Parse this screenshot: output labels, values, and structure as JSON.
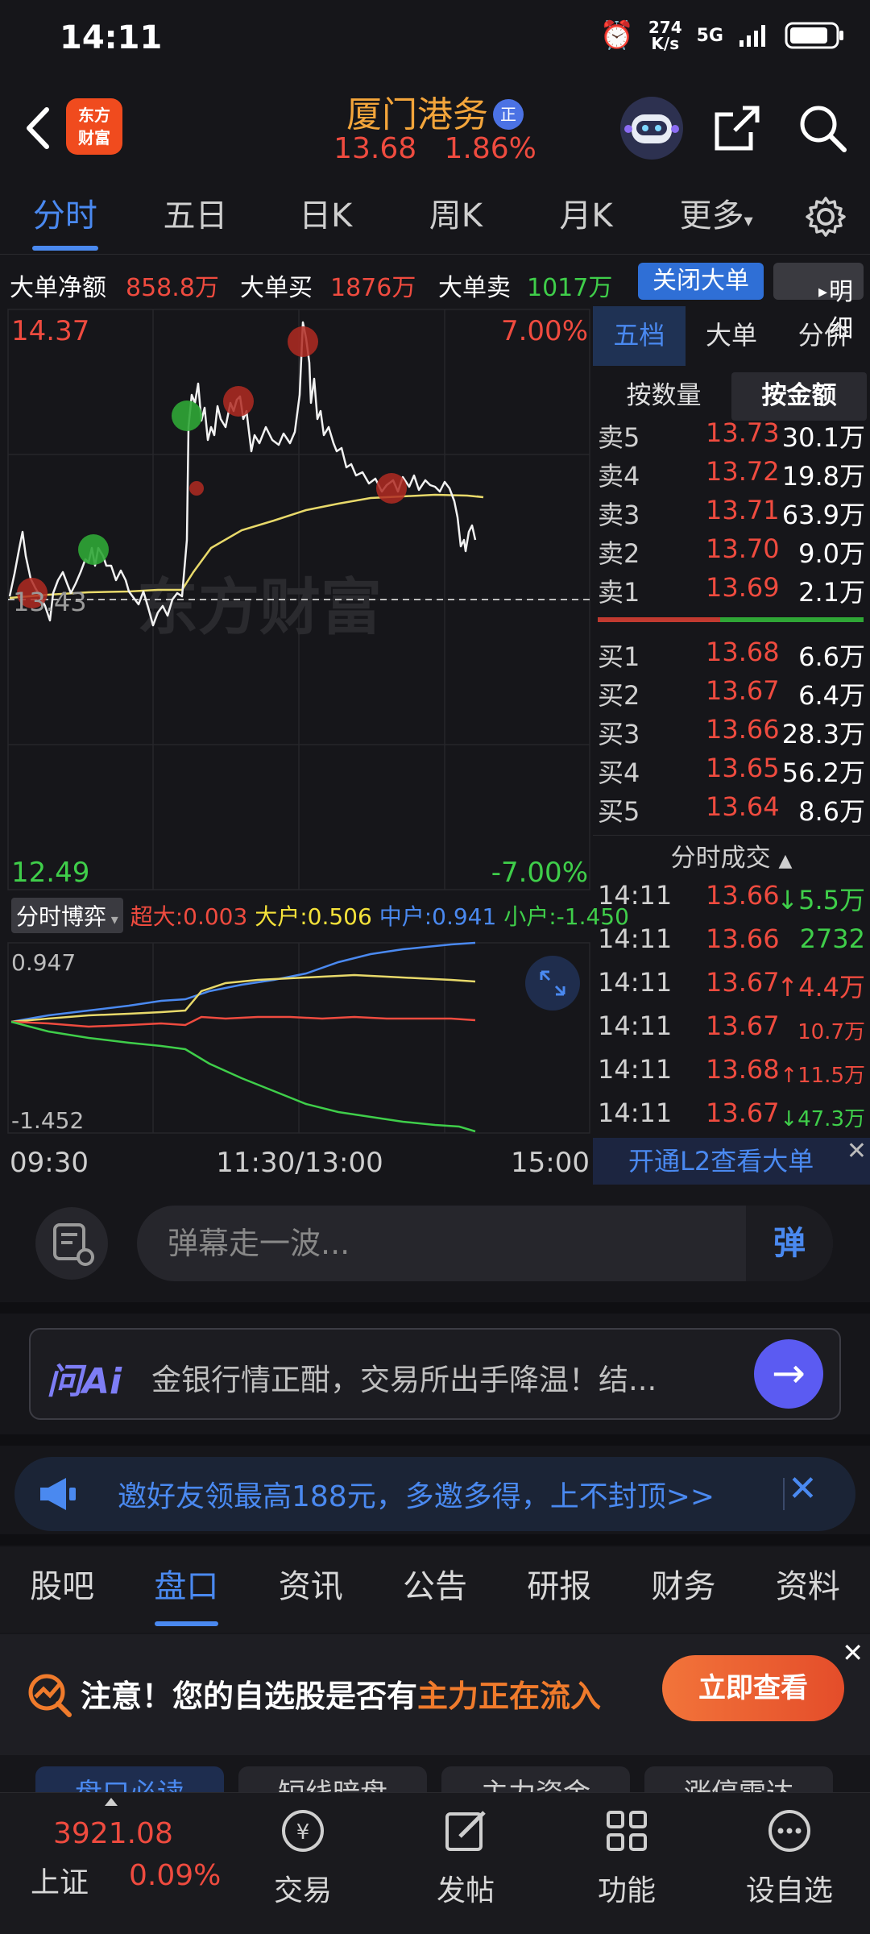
{
  "status_bar": {
    "time": "14:11",
    "net_speed_top": "274",
    "net_speed_bottom": "K/s",
    "network": "5G"
  },
  "header": {
    "logo_line1": "东方",
    "logo_line2": "财富",
    "stock_name": "厦门港务",
    "tag": "正",
    "price": "13.68",
    "change_pct": "1.86%"
  },
  "tabs": [
    "分时",
    "五日",
    "日K",
    "周K",
    "月K",
    "更多"
  ],
  "big_order": {
    "net_label": "大单净额",
    "net_value": "858.8万",
    "buy_label": "大单买",
    "buy_value": "1876万",
    "sell_label": "大单卖",
    "sell_value": "1017万",
    "close_btn": "关闭大单",
    "detail_btn": "明细"
  },
  "chart": {
    "price_high": "14.37",
    "pct_high": "7.00%",
    "price_low": "12.49",
    "pct_low": "-7.00%",
    "ref_price": "13.43",
    "watermark": "东方财富",
    "sub_selector": "分时博弈",
    "sub_legend": [
      {
        "label": "超大:",
        "value": "0.003",
        "color": "#ef4b3f"
      },
      {
        "label": "大户:",
        "value": "0.506",
        "color": "#f5e23a"
      },
      {
        "label": "中户:",
        "value": "0.941",
        "color": "#4a89f0"
      },
      {
        "label": "小户:",
        "value": "-1.450",
        "color": "#3fce4a"
      }
    ],
    "sub_max": "0.947",
    "sub_min": "-1.452",
    "time_labels": [
      "09:30",
      "11:30/13:00",
      "15:00"
    ]
  },
  "right_panel": {
    "tabs": [
      "五档",
      "大单",
      "分价"
    ],
    "seg": [
      "按数量",
      "按金额"
    ],
    "sells": [
      {
        "label": "卖5",
        "price": "13.73",
        "vol": "30.1万"
      },
      {
        "label": "卖4",
        "price": "13.72",
        "vol": "19.8万"
      },
      {
        "label": "卖3",
        "price": "13.71",
        "vol": "63.9万"
      },
      {
        "label": "卖2",
        "price": "13.70",
        "vol": "9.0万"
      },
      {
        "label": "卖1",
        "price": "13.69",
        "vol": "2.1万"
      }
    ],
    "buys": [
      {
        "label": "买1",
        "price": "13.68",
        "vol": "6.6万"
      },
      {
        "label": "买2",
        "price": "13.67",
        "vol": "6.4万"
      },
      {
        "label": "买3",
        "price": "13.66",
        "vol": "28.3万"
      },
      {
        "label": "买4",
        "price": "13.65",
        "vol": "56.2万"
      },
      {
        "label": "买5",
        "price": "13.64",
        "vol": "8.6万"
      }
    ],
    "ticks_title": "分时成交",
    "ticks": [
      {
        "time": "14:11",
        "price": "13.66",
        "vol": "↓5.5万",
        "color": "#3fce4a"
      },
      {
        "time": "14:11",
        "price": "13.66",
        "vol": "2732",
        "color": "#3fce4a"
      },
      {
        "time": "14:11",
        "price": "13.67",
        "vol": "↑4.4万",
        "color": "#ef4b3f"
      },
      {
        "time": "14:11",
        "price": "13.67",
        "vol": "10.7万",
        "color": "#ef4b3f"
      },
      {
        "time": "14:11",
        "price": "13.68",
        "vol": "↑11.5万",
        "color": "#ef4b3f"
      },
      {
        "time": "14:11",
        "price": "13.67",
        "vol": "↓47.3万",
        "color": "#3fce4a"
      }
    ],
    "l2_link": "开通L2查看大单"
  },
  "danmu": {
    "placeholder": "弹幕走一波...",
    "btn": "弹"
  },
  "ai": {
    "logo": "问Ai",
    "text": "金银行情正酣，交易所出手降温！结..."
  },
  "invite": {
    "text": "邀好友领最高188元，多邀多得，上不封顶>>"
  },
  "bottom_tabs": [
    "股吧",
    "盘口",
    "资讯",
    "公告",
    "研报",
    "财务",
    "资料"
  ],
  "alert": {
    "prefix": "注意！您的自选股是否有",
    "highlight": "主力正在流入",
    "button": "立即查看"
  },
  "chips": [
    "盘口必读",
    "短线暗盘",
    "主力资金",
    "涨停雷达"
  ],
  "footer": {
    "index_value": "3921.08",
    "index_name": "上证",
    "index_pct": "0.09%",
    "nav": [
      "交易",
      "发帖",
      "功能",
      "设自选"
    ]
  },
  "colors": {
    "up": "#ef4b3f",
    "down": "#3fce4a",
    "accent": "#4a89f0",
    "brand": "#f04b1e"
  }
}
